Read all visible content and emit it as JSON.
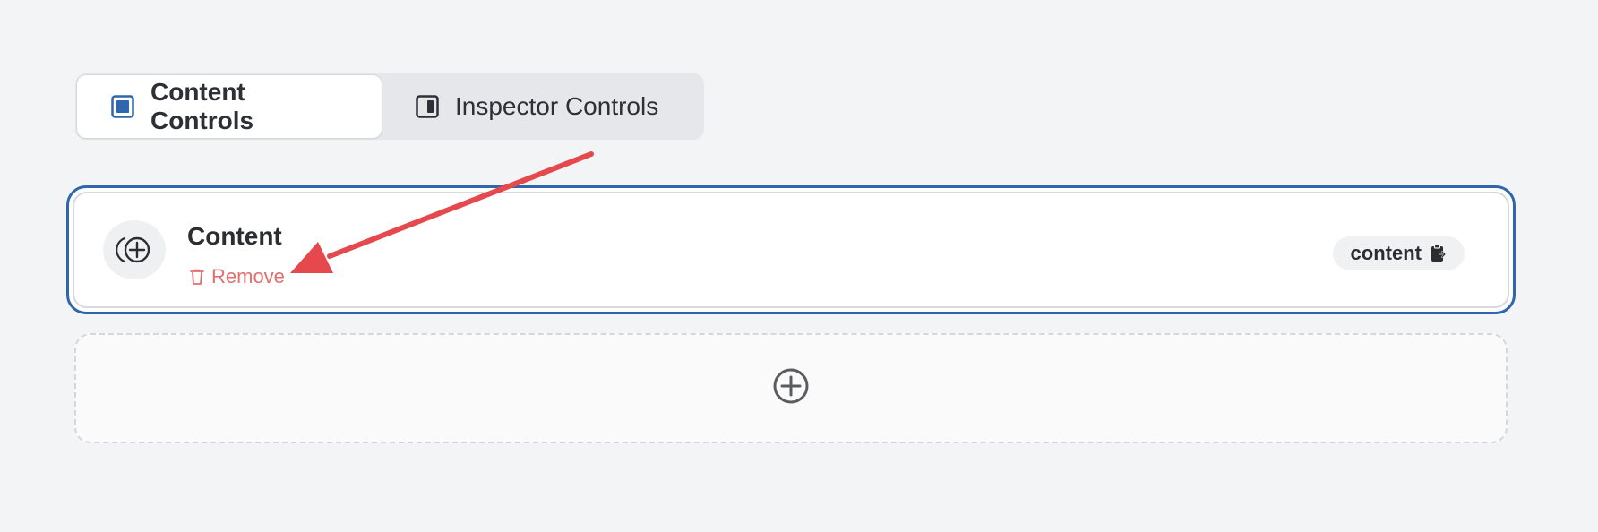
{
  "tabs": [
    {
      "label": "Content Controls",
      "icon": "content-panel-icon",
      "active": true
    },
    {
      "label": "Inspector Controls",
      "icon": "inspector-panel-icon",
      "active": false
    }
  ],
  "block": {
    "title": "Content",
    "icon": "add-circle-icon",
    "remove_label": "Remove",
    "pill_label": "content",
    "pill_icon": "clipboard-icon"
  },
  "add_zone": {
    "icon": "plus-circle-icon"
  },
  "colors": {
    "accent": "#2f66ad",
    "danger": "#e26f6f",
    "annotation": "#e5484d"
  }
}
